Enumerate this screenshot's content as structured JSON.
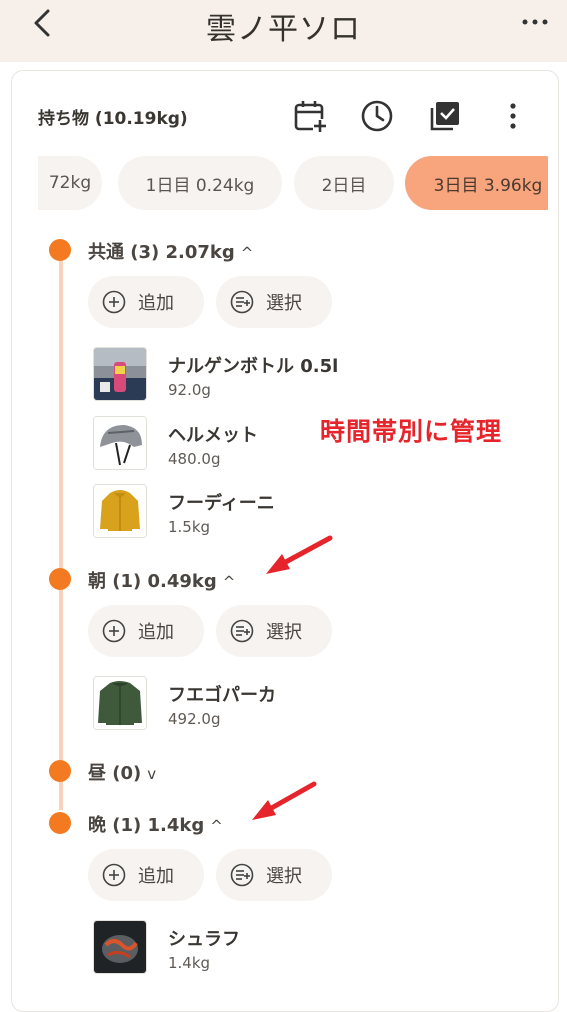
{
  "header": {
    "title": "雲ノ平ソロ"
  },
  "section": {
    "title": "持ち物 (10.19kg)"
  },
  "tabs": [
    {
      "label": "72kg"
    },
    {
      "label": "1日目 0.24kg"
    },
    {
      "label": "2日目"
    },
    {
      "label": "3日目 3.96kg"
    }
  ],
  "groups": [
    {
      "label": "共通 (3) 2.07kg",
      "caret": "^",
      "add_label": "追加",
      "select_label": "選択",
      "items": [
        {
          "name": "ナルゲンボトル 0.5l",
          "weight": "92.0g"
        },
        {
          "name": "ヘルメット",
          "weight": "480.0g"
        },
        {
          "name": "フーディーニ",
          "weight": "1.5kg"
        }
      ]
    },
    {
      "label": "朝 (1) 0.49kg",
      "caret": "^",
      "add_label": "追加",
      "select_label": "選択",
      "items": [
        {
          "name": "フエゴパーカ",
          "weight": "492.0g"
        }
      ]
    },
    {
      "label": "昼 (0)",
      "caret": "v"
    },
    {
      "label": "晩 (1) 1.4kg",
      "caret": "^",
      "add_label": "追加",
      "select_label": "選択",
      "items": [
        {
          "name": "シュラフ",
          "weight": "1.4kg"
        }
      ]
    }
  ],
  "annotation": {
    "text": "時間帯別に管理"
  },
  "colors": {
    "accent": "#f47a22",
    "active_tab": "#f8a47c",
    "annotation": "#e5252b",
    "header_bg": "#f7f0ea"
  }
}
